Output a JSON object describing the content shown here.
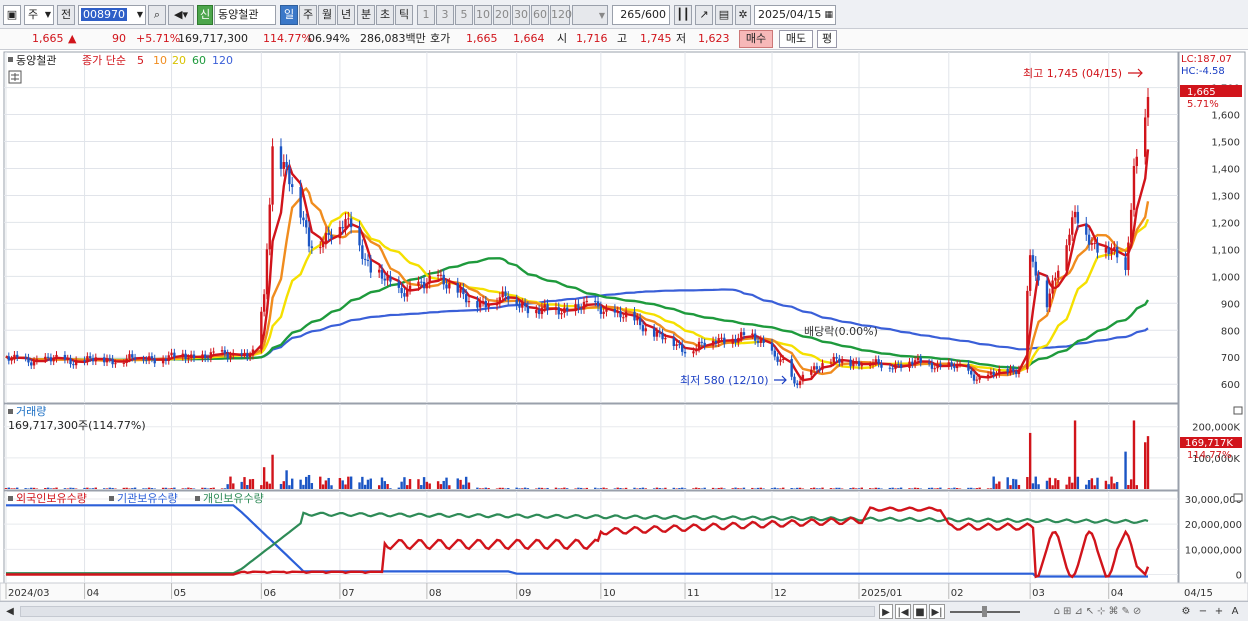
{
  "toolbar": {
    "market": "주",
    "prev_label": "전",
    "code": "008970",
    "new_badge": "신",
    "name": "동양철관",
    "periods": [
      "일",
      "주",
      "월",
      "년",
      "분",
      "초",
      "틱"
    ],
    "intervals": [
      "1",
      "3",
      "5",
      "10",
      "20",
      "30",
      "60",
      "120"
    ],
    "count": "265",
    "count_total": "/600",
    "date": "2025/04/15"
  },
  "quote": {
    "price": "1,665",
    "arrow": "▲",
    "change": "90",
    "change_pct": "+5.71%",
    "volume": "169,717,300",
    "volume_pct": "114.77%",
    "turnover": "06.94%",
    "amount": "286,083백만",
    "hoga_label": "호가",
    "ask": "1,665",
    "bid": "1,664",
    "open_label": "시",
    "open": "1,716",
    "high_label": "고",
    "high": "1,745",
    "low_label": "저",
    "low": "1,623",
    "buy_label": "매수",
    "sell_label": "매도",
    "eval_label": "평"
  },
  "colors": {
    "up": "#d1141b",
    "down": "#1b55c4",
    "ma5": "#d1141b",
    "ma10": "#f08c1e",
    "ma20": "#f5e000",
    "ma60": "#1e9a3c",
    "ma120": "#3a5fd8",
    "foreign": "#d1141b",
    "institution": "#2b5fd8",
    "individual": "#2e8b57"
  },
  "chart_data": [
    {
      "type": "candlestick",
      "legend_name": "동양철관",
      "legend_ma_label": "종가 단순",
      "ma_periods": [
        "5",
        "10",
        "20",
        "60",
        "120"
      ],
      "y_ticks": [
        "600",
        "700",
        "800",
        "900",
        "1,000",
        "1,100",
        "1,200",
        "1,300",
        "1,400",
        "1,500",
        "1,600",
        "1,700"
      ],
      "ylim": [
        560,
        1780
      ],
      "x_ticks": [
        "2024/03",
        "04",
        "05",
        "06",
        "07",
        "08",
        "09",
        "10",
        "11",
        "12",
        "2025/01",
        "02",
        "03",
        "04"
      ],
      "x_end_label": "04/15",
      "lc_label": "LC:187.07",
      "hc_label": "HC:-4.58",
      "last_price": "1,665",
      "last_pct": "5.71%",
      "high_note": "최고 1,745 (04/15)",
      "low_note": "최저 580 (12/10)",
      "dividend_note": "배당락(0.00%)",
      "closes": [
        {
          "date": "2024/03/04",
          "close": 690
        },
        {
          "date": "2024/04/01",
          "close": 688
        },
        {
          "date": "2024/05/02",
          "close": 700
        },
        {
          "date": "2024/05/31",
          "close": 712
        },
        {
          "date": "2024/06/04",
          "close": 910
        },
        {
          "date": "2024/06/07",
          "close": 1480
        },
        {
          "date": "2024/06/12",
          "close": 1400
        },
        {
          "date": "2024/06/20",
          "close": 1120
        },
        {
          "date": "2024/06/28",
          "close": 1160
        },
        {
          "date": "2024/07/05",
          "close": 1200
        },
        {
          "date": "2024/07/12",
          "close": 1020
        },
        {
          "date": "2024/07/22",
          "close": 950
        },
        {
          "date": "2024/07/31",
          "close": 960
        },
        {
          "date": "2024/08/05",
          "close": 1010
        },
        {
          "date": "2024/08/16",
          "close": 900
        },
        {
          "date": "2024/08/30",
          "close": 920
        },
        {
          "date": "2024/09/10",
          "close": 870
        },
        {
          "date": "2024/09/20",
          "close": 880
        },
        {
          "date": "2024/09/30",
          "close": 890
        },
        {
          "date": "2024/10/15",
          "close": 830
        },
        {
          "date": "2024/10/31",
          "close": 730
        },
        {
          "date": "2024/11/12",
          "close": 760
        },
        {
          "date": "2024/11/22",
          "close": 780
        },
        {
          "date": "2024/11/29",
          "close": 750
        },
        {
          "date": "2024/12/06",
          "close": 680
        },
        {
          "date": "2024/12/10",
          "close": 590
        },
        {
          "date": "2024/12/16",
          "close": 660
        },
        {
          "date": "2024/12/27",
          "close": 690
        },
        {
          "date": "2025/01/10",
          "close": 670
        },
        {
          "date": "2025/01/24",
          "close": 680
        },
        {
          "date": "2025/02/07",
          "close": 660
        },
        {
          "date": "2025/02/14",
          "close": 620
        },
        {
          "date": "2025/02/28",
          "close": 660
        },
        {
          "date": "2025/03/04",
          "close": 1060
        },
        {
          "date": "2025/03/10",
          "close": 900
        },
        {
          "date": "2025/03/14",
          "close": 1050
        },
        {
          "date": "2025/03/20",
          "close": 1220
        },
        {
          "date": "2025/03/26",
          "close": 1120
        },
        {
          "date": "2025/04/02",
          "close": 1100
        },
        {
          "date": "2025/04/07",
          "close": 1000
        },
        {
          "date": "2025/04/10",
          "close": 1400
        },
        {
          "date": "2025/04/14",
          "close": 1575
        },
        {
          "date": "2025/04/15",
          "close": 1665
        }
      ]
    },
    {
      "type": "bar",
      "title": "거래량",
      "current": "169,717,300주(114.77%)",
      "y_ticks": [
        "100,000K",
        "200,000K"
      ],
      "last_label": "169,717K",
      "last_pct": "114.77%",
      "ylim": [
        0,
        260000
      ],
      "values_k": [
        {
          "date": "2024/06/04",
          "volume_k": 70000
        },
        {
          "date": "2024/06/07",
          "volume_k": 110000
        },
        {
          "date": "2024/06/12",
          "volume_k": 60000
        },
        {
          "date": "2024/06/20",
          "volume_k": 45000
        },
        {
          "date": "2024/07/05",
          "volume_k": 40000
        },
        {
          "date": "2024/08/05",
          "volume_k": 25000
        },
        {
          "date": "2025/03/04",
          "volume_k": 180000
        },
        {
          "date": "2025/03/20",
          "volume_k": 220000
        },
        {
          "date": "2025/04/07",
          "volume_k": 120000
        },
        {
          "date": "2025/04/10",
          "volume_k": 220000
        },
        {
          "date": "2025/04/14",
          "volume_k": 150000
        },
        {
          "date": "2025/04/15",
          "volume_k": 169717
        }
      ]
    },
    {
      "type": "line",
      "legend": [
        "외국인보유수량",
        "기관보유수량",
        "개인보유수량"
      ],
      "y_ticks": [
        "0",
        "10,000,000",
        "20,000,000",
        "30,000,000"
      ],
      "ylim": [
        -3000000,
        32000000
      ]
    }
  ],
  "scroller": {
    "buttons": [
      "▶",
      "|◀",
      "■",
      "▶|"
    ],
    "tools": [
      "−",
      "+",
      "A"
    ]
  }
}
